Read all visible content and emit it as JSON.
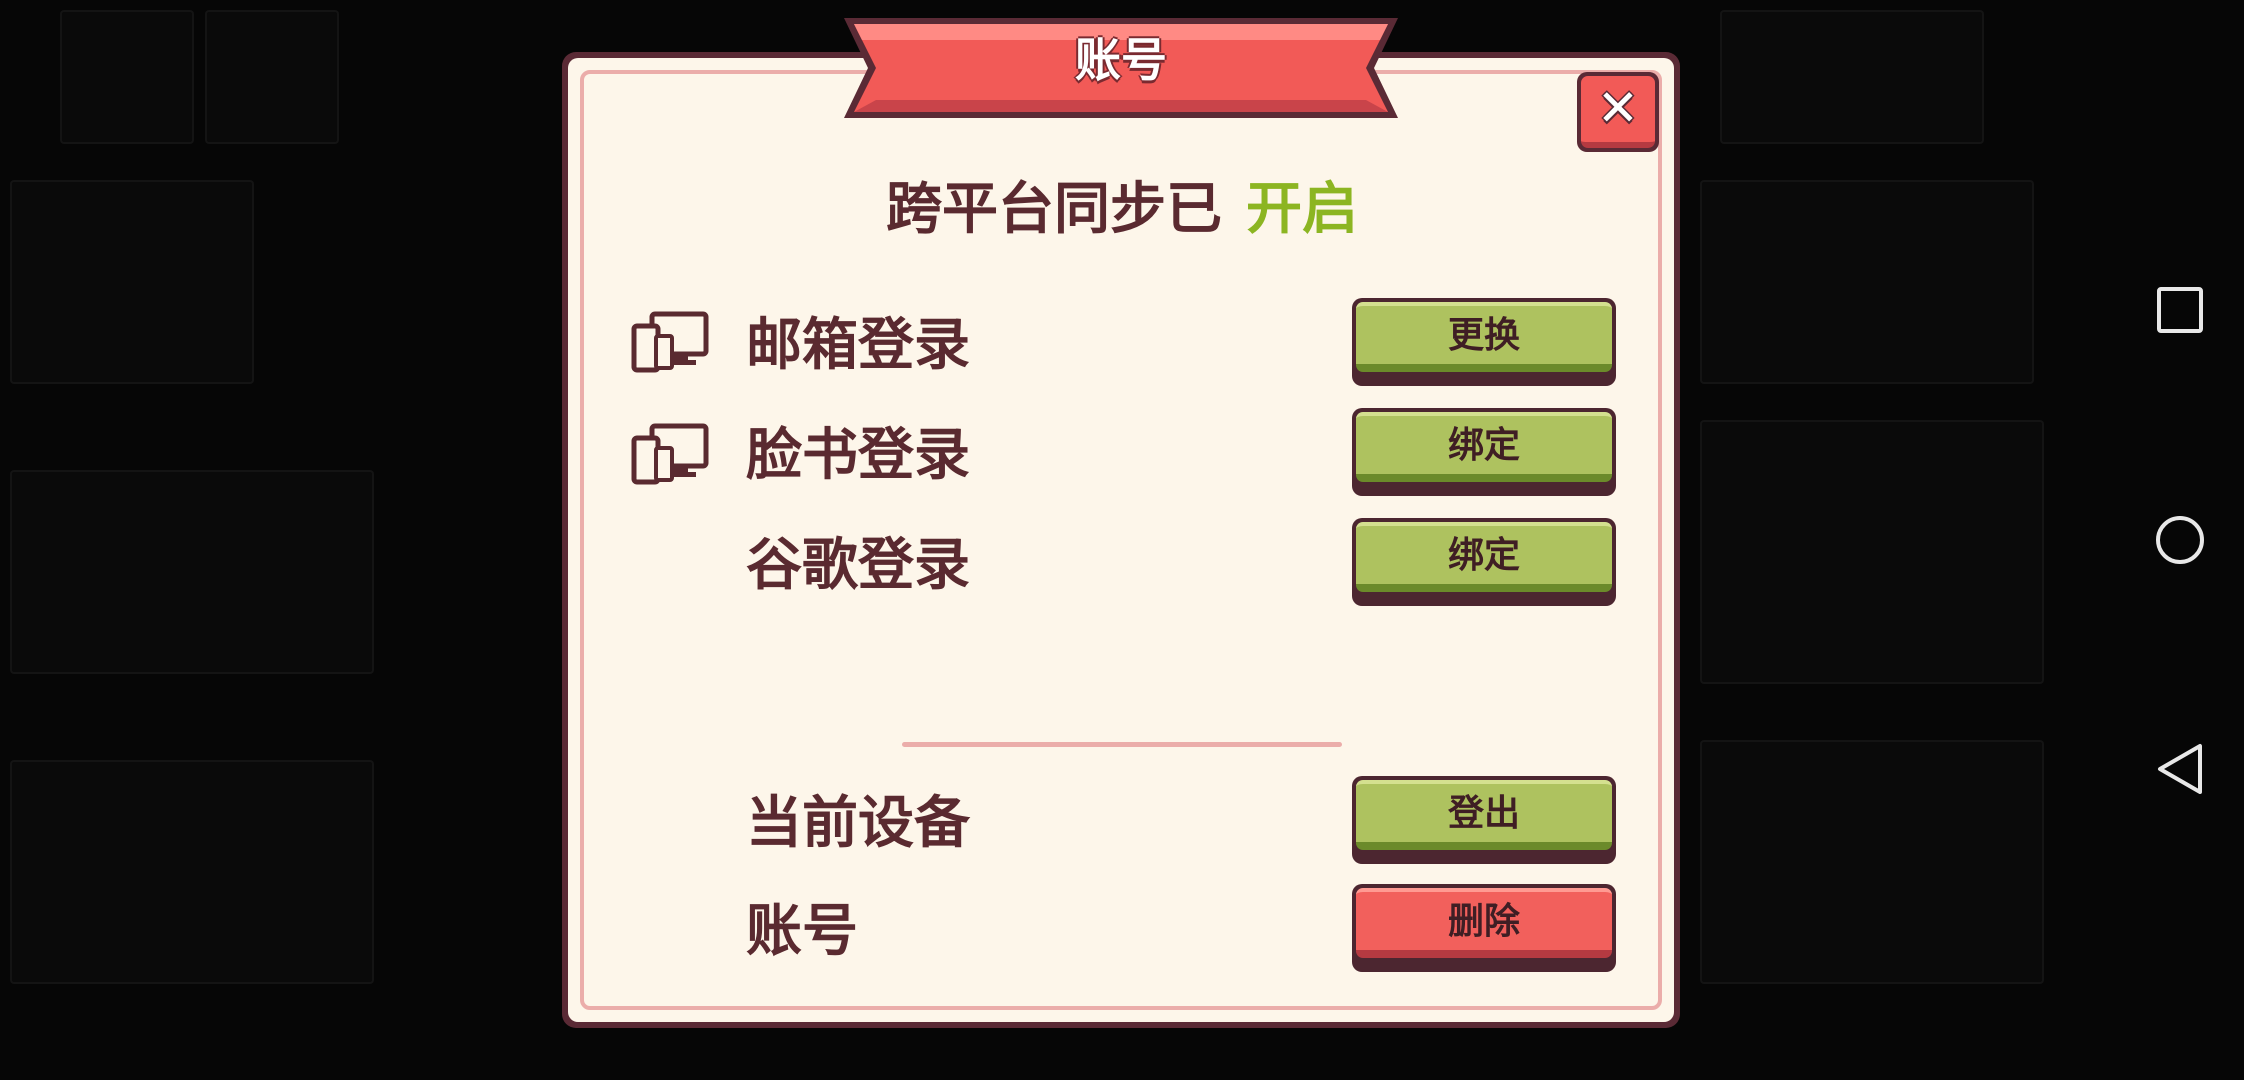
{
  "dialog": {
    "title": "账号",
    "close_label": "✕",
    "sync_text": "跨平台同步已",
    "sync_state": "开启",
    "rows": [
      {
        "label": "邮箱登录",
        "button": "更换",
        "has_device_icon": true
      },
      {
        "label": "脸书登录",
        "button": "绑定",
        "has_device_icon": true
      },
      {
        "label": "谷歌登录",
        "button": "绑定",
        "has_device_icon": false
      }
    ],
    "current_device": {
      "label": "当前设备",
      "button": "登出"
    },
    "account": {
      "label": "账号",
      "button": "删除"
    }
  },
  "colors": {
    "accent_green": "#8cb522",
    "button_green": "#aec25f",
    "button_red": "#f2605c",
    "text_dark": "#5a2a30",
    "panel_bg": "#fdf6ea"
  },
  "nav_bar": {
    "icons": [
      "square-recents-icon",
      "circle-home-icon",
      "triangle-back-icon"
    ]
  }
}
